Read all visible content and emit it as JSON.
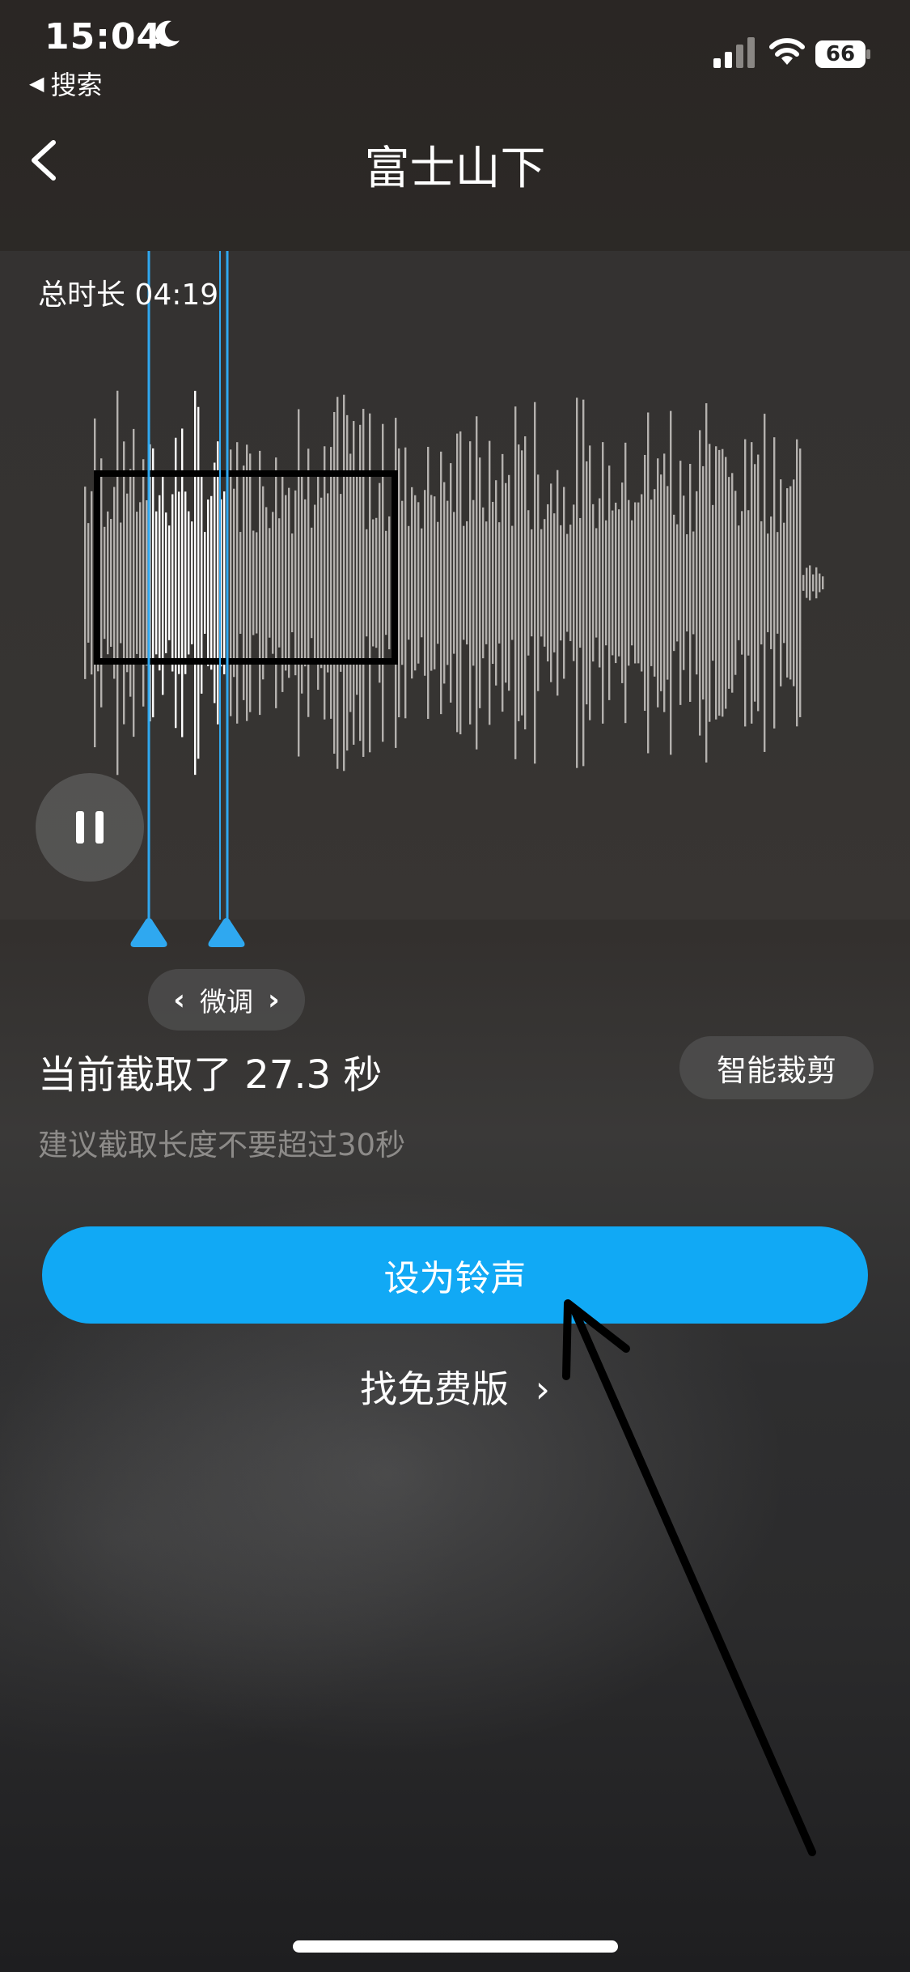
{
  "status_bar": {
    "time": "15:04",
    "back_app_label": "搜索",
    "battery": "66",
    "icons": [
      "moon-icon",
      "signal-icon",
      "wifi-icon",
      "battery-icon"
    ]
  },
  "nav": {
    "back_icon": "chevron-left-icon",
    "title": "富士山下"
  },
  "editor": {
    "total_duration_label": "总时长 04:19",
    "play_state_icon": "pause-icon",
    "selection_color": "#2fa8f0"
  },
  "controls": {
    "fine_tune_label": "微调",
    "clip_info": "当前截取了 27.3 秒",
    "smart_trim_label": "智能裁剪",
    "tip": "建议截取长度不要超过30秒",
    "set_ringtone_label": "设为铃声",
    "free_version_label": "找免费版",
    "free_version_icon": "chevron-right-icon"
  },
  "colors": {
    "accent": "#11a9f5",
    "handle": "#2fa8f0"
  }
}
